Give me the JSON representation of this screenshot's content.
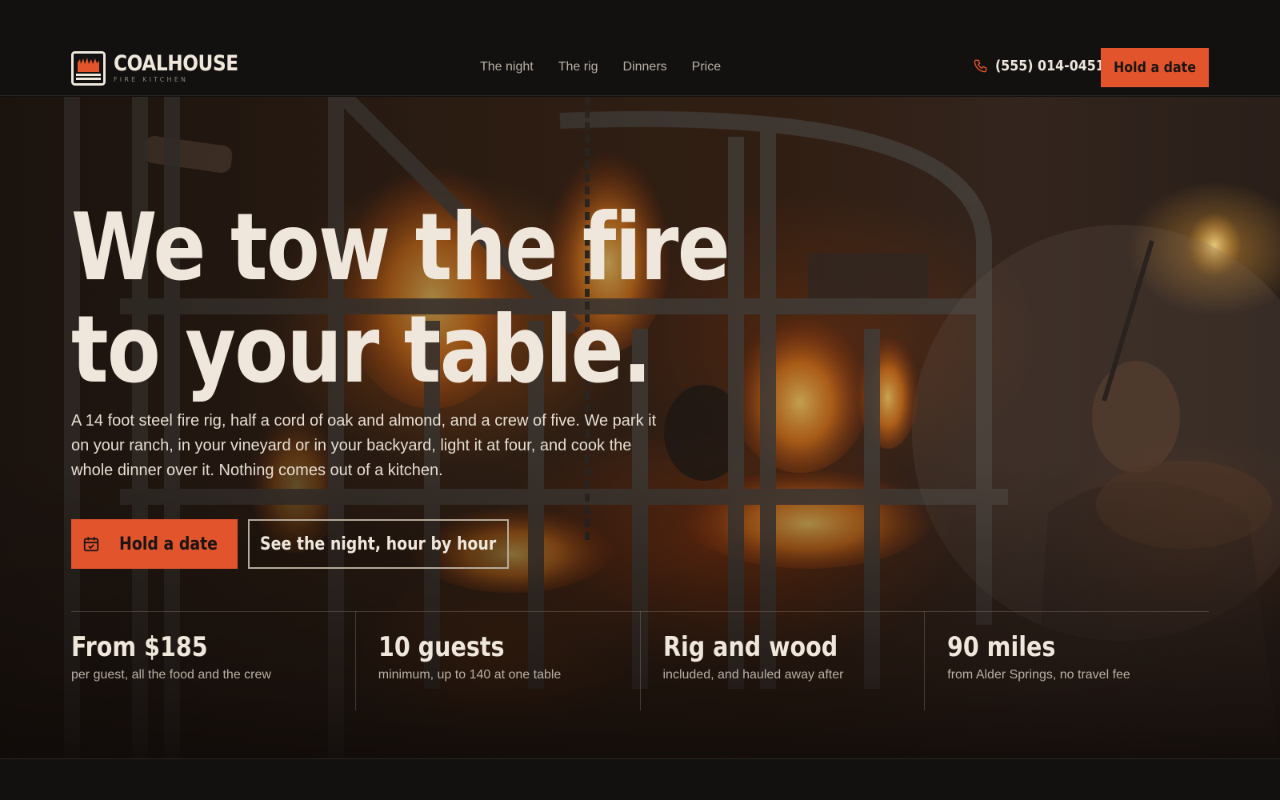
{
  "brand": {
    "name": "COALHOUSE",
    "tagline": "FIRE KITCHEN"
  },
  "nav": {
    "items": [
      {
        "label": "The night"
      },
      {
        "label": "The rig"
      },
      {
        "label": "Dinners"
      },
      {
        "label": "Price"
      }
    ]
  },
  "header": {
    "phone": "(555) 014-0451",
    "cta_label": "Hold a date"
  },
  "hero": {
    "title_line1": "We tow the fire",
    "title_line2": "to your table.",
    "description": "A 14 foot steel fire rig, half a cord of oak and almond, and a crew of five. We park it on your ranch, in your vineyard or in your backyard, light it at four, and cook the whole dinner over it. Nothing comes out of a kitchen.",
    "primary_cta": "Hold a date",
    "secondary_cta": "See the night, hour by hour"
  },
  "stats": [
    {
      "value": "From $185",
      "label": "per guest, all the food and the crew"
    },
    {
      "value": "10 guests",
      "label": "minimum, up to 140 at one table"
    },
    {
      "value": "Rig and wood",
      "label": "included, and hauled away after"
    },
    {
      "value": "90 miles",
      "label": "from Alder Springs, no travel fee"
    }
  ],
  "icons": {
    "logo": "grill-logo-icon",
    "phone": "phone-icon",
    "calendar": "calendar-icon"
  },
  "colors": {
    "accent": "#e2542c",
    "background": "#121110",
    "text": "#efe7dc",
    "muted": "#b9afa3"
  }
}
